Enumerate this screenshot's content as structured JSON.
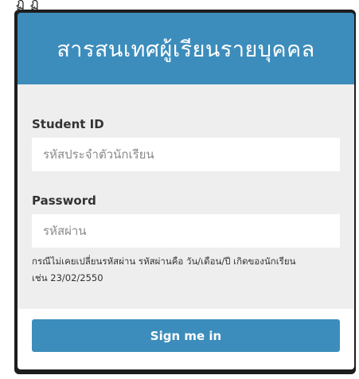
{
  "header": {
    "title": "สารสนเทศผู้เรียนรายบุคคล"
  },
  "top_clip": "ฏ ฏ",
  "form": {
    "student_id": {
      "label": "Student ID",
      "placeholder": "รหัสประจำตัวนักเรียน",
      "value": ""
    },
    "password": {
      "label": "Password",
      "placeholder": "รหัสผ่าน",
      "value": ""
    },
    "hint_line1": "กรณีไม่เคยเปลี่ยนรหัสผ่าน รหัสผ่านคือ วัน/เดือน/ปี เกิดของนักเรียน",
    "hint_line2": "เช่น 23/02/2550"
  },
  "footer": {
    "submit_label": "Sign me in"
  },
  "colors": {
    "accent": "#3c8dbc",
    "body_bg": "#eeeeee",
    "frame": "#1d1d1d"
  }
}
